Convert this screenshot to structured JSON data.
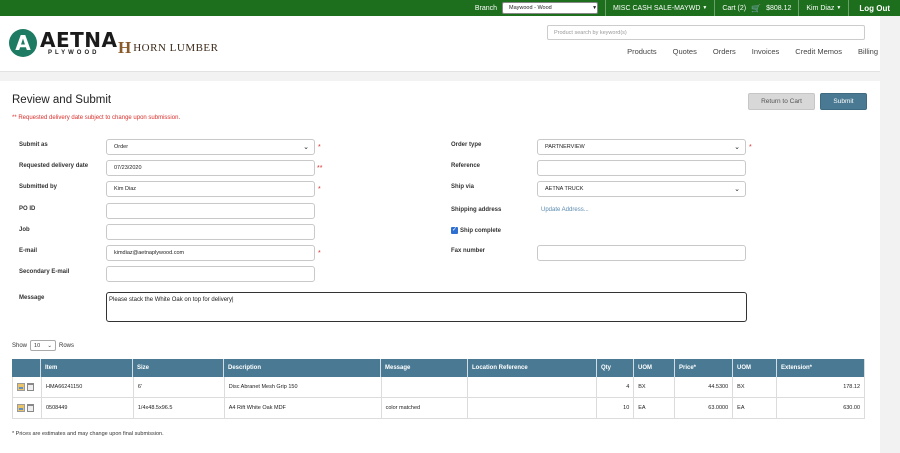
{
  "topbar": {
    "branch_label": "Branch",
    "branch_value": "Maywood - Wood",
    "account": "MISC CASH SALE-MAYWD",
    "cart_label": "Cart (2)",
    "cart_total": "$808.12",
    "user": "Kim Diaz",
    "logout": "Log Out"
  },
  "brand": {
    "aetna_mark": "A",
    "aetna_name": "AETNA",
    "aetna_sub": "PLYWOOD",
    "horn_mark": "H",
    "horn_name": "HORN LUMBER"
  },
  "search": {
    "placeholder": "Product search by keyword(s)"
  },
  "nav": [
    "Products",
    "Quotes",
    "Orders",
    "Invoices",
    "Credit Memos",
    "Billing"
  ],
  "page": {
    "title": "Review and Submit",
    "note": "** Requested delivery date subject to change upon submission.",
    "return_button": "Return to Cart",
    "submit_button": "Submit"
  },
  "form_left": {
    "submit_as_label": "Submit as",
    "submit_as_value": "Order",
    "req_date_label": "Requested delivery date",
    "req_date_value": "07/23/2020",
    "submitted_by_label": "Submitted by",
    "submitted_by_value": "Kim Diaz",
    "po_label": "PO ID",
    "po_value": "",
    "job_label": "Job",
    "job_value": "",
    "email_label": "E-mail",
    "email_value": "kimdiaz@aetnaplywood.com",
    "secondary_email_label": "Secondary E-mail",
    "secondary_email_value": "",
    "message_label": "Message",
    "message_value": "Please stack the White Oak on top for delivery|"
  },
  "form_right": {
    "order_type_label": "Order type",
    "order_type_value": "PARTNERVIEW",
    "reference_label": "Reference",
    "reference_value": "",
    "ship_via_label": "Ship via",
    "ship_via_value": "AETNA TRUCK",
    "shipping_address_label": "Shipping address",
    "shipping_address_link": "Update Address...",
    "ship_complete_label": "Ship complete",
    "fax_label": "Fax number",
    "fax_value": ""
  },
  "markers": {
    "required": "*",
    "double": "**"
  },
  "table_controls": {
    "show": "Show",
    "rows_value": "10",
    "rows": "Rows"
  },
  "table": {
    "headers": [
      "",
      "Item",
      "Size",
      "Description",
      "Message",
      "Location Reference",
      "Qty",
      "UOM",
      "Price*",
      "UOM",
      "Extension*"
    ],
    "rows": [
      [
        "",
        "HMA66241150",
        "6'",
        "Disc Abranet Mesh Grip 150",
        "",
        "",
        "4",
        "BX",
        "44.5300",
        "BX",
        "178.12"
      ],
      [
        "",
        "0508449",
        "1/4x48.5x96.5",
        "A4 Rift White Oak MDF",
        "color matched",
        "",
        "10",
        "EA",
        "63.0000",
        "EA",
        "630.00"
      ]
    ]
  },
  "footnote": "* Prices are estimates and may change upon final submission.",
  "colors": {
    "topbar": "#1d6e1d",
    "accent": "#4a7a93",
    "required": "#d9302c",
    "link": "#5b8bb0"
  }
}
